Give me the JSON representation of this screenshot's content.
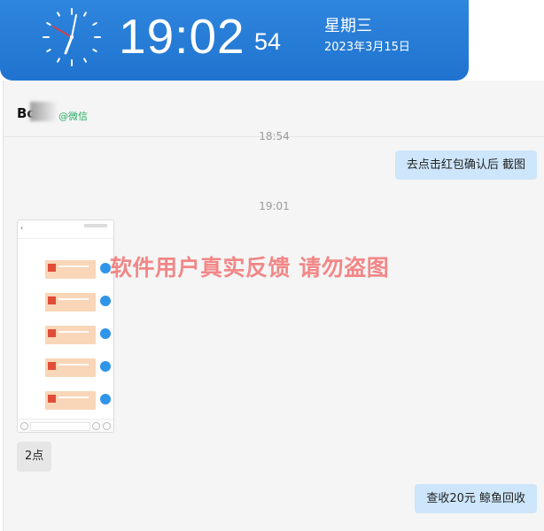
{
  "clock": {
    "time": "19:02",
    "seconds": "54",
    "weekday": "星期三",
    "date": "2023年3月15日"
  },
  "chat": {
    "contact_name": "Bo",
    "contact_source": "@微信",
    "messages": [
      {
        "type": "timestamp",
        "text": "18:54"
      },
      {
        "type": "text",
        "side": "right",
        "text": "去点击红包确认后  截图"
      },
      {
        "type": "timestamp",
        "text": "19:01"
      },
      {
        "type": "image",
        "side": "left"
      },
      {
        "type": "text",
        "side": "left",
        "text": "2点"
      },
      {
        "type": "text",
        "side": "right",
        "text": "查收20元    鲸鱼回收"
      }
    ]
  },
  "watermark": "软件用户真实反馈  请勿盗图",
  "icons": [
    "clock-icon",
    "back-arrow-icon",
    "red-packet-icon",
    "avatar-icon",
    "voice-icon",
    "emoji-icon",
    "plus-icon"
  ]
}
